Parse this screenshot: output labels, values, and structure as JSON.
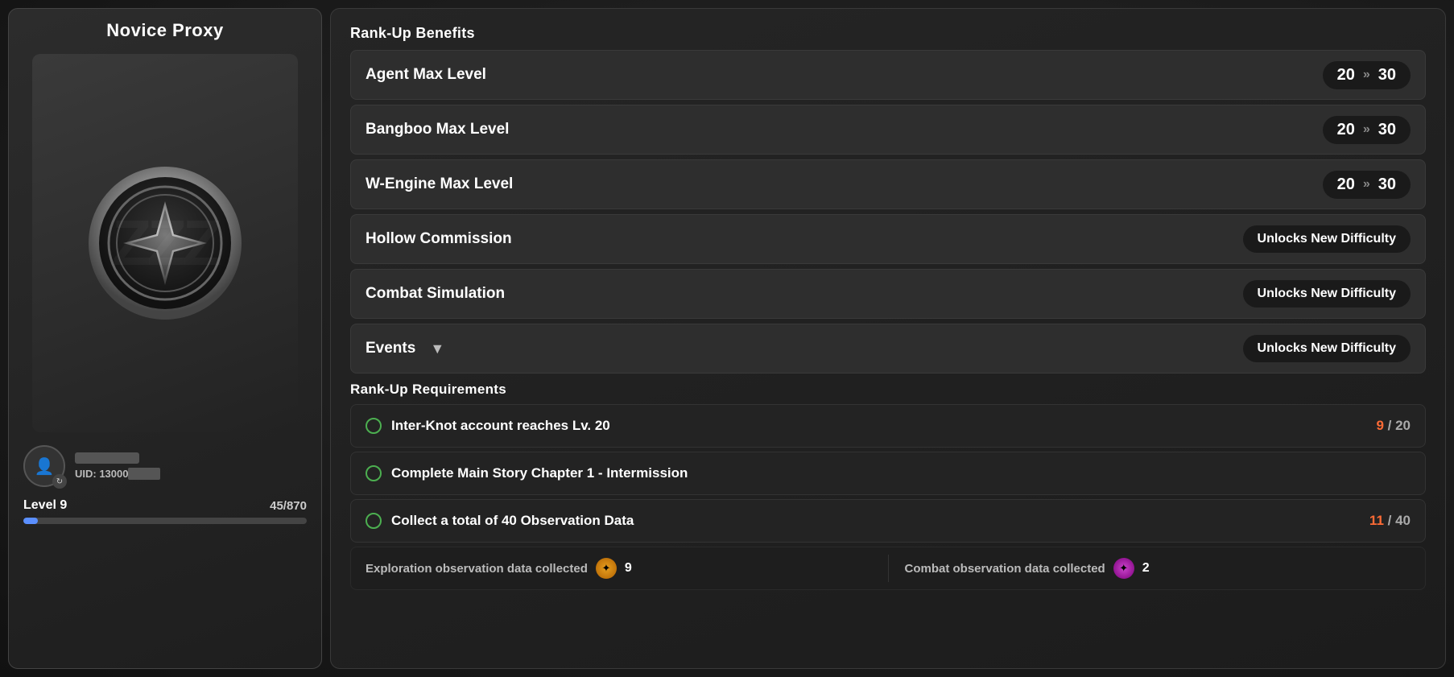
{
  "left": {
    "title": "Novice Proxy",
    "user": {
      "uid_prefix": "UID: 13000",
      "uid_hidden": "●●●●●",
      "level_label": "Level 9",
      "level_num": "9",
      "exp_current": "45",
      "exp_max": "870",
      "exp_display": "45/870",
      "exp_percent": 5.17
    }
  },
  "right": {
    "benefits_title": "Rank-Up Benefits",
    "benefits": [
      {
        "label": "Agent Max Level",
        "from": "20",
        "to": "30",
        "type": "level"
      },
      {
        "label": "Bangboo Max Level",
        "from": "20",
        "to": "30",
        "type": "level"
      },
      {
        "label": "W-Engine Max Level",
        "from": "20",
        "to": "30",
        "type": "level"
      },
      {
        "label": "Hollow Commission",
        "badge": "Unlocks New Difficulty",
        "type": "unlock"
      },
      {
        "label": "Combat Simulation",
        "badge": "Unlocks New Difficulty",
        "type": "unlock"
      }
    ],
    "events_label": "Events",
    "events_badge": "Unlocks New Difficulty",
    "requirements_title": "Rank-Up Requirements",
    "requirements": [
      {
        "label": "Inter-Knot account reaches Lv. 20",
        "current": "9",
        "total": "20",
        "has_progress": true
      },
      {
        "label": "Complete Main Story Chapter 1 - Intermission",
        "has_progress": false
      },
      {
        "label": "Collect a total of 40 Observation Data",
        "current": "11",
        "total": "40",
        "has_progress": true
      }
    ],
    "obs_explore_label": "Exploration observation data collected",
    "obs_explore_count": "9",
    "obs_combat_label": "Combat observation data collected",
    "obs_combat_count": "2",
    "chevron_symbol": "»",
    "unlock_label": "Unlocks New Difficulty"
  }
}
